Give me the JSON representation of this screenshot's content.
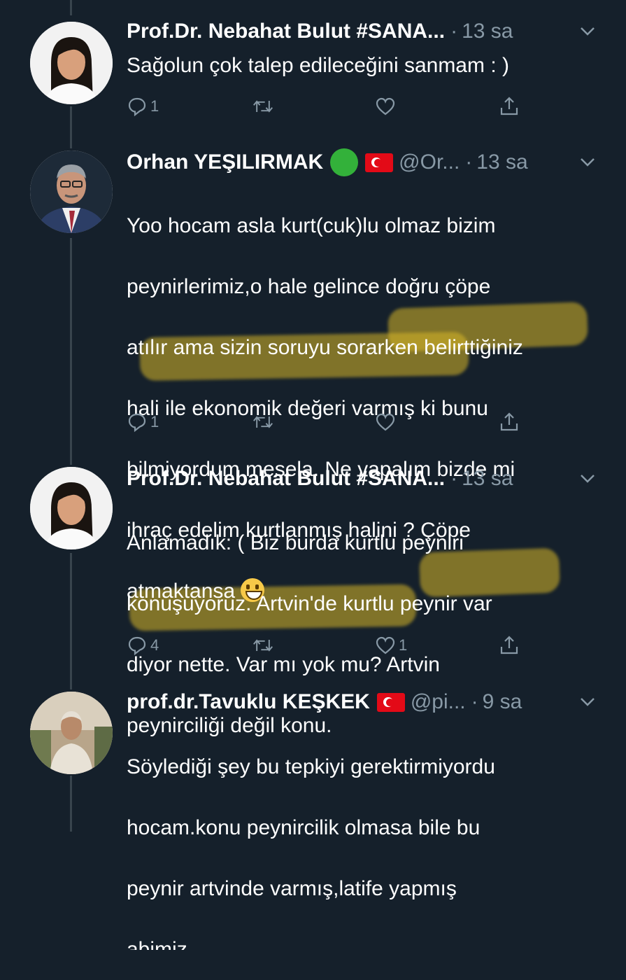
{
  "tweets": [
    {
      "name": "Prof.Dr. Nebahat Bulut #SANA...",
      "handle": "",
      "time": "13 sa",
      "text": "Sağolun çok talep edileceğini sanmam : )",
      "reply_count": "1",
      "like_count": ""
    },
    {
      "name": "Orhan YEŞILIRMAK",
      "handle": "@Or...",
      "time": "13 sa",
      "text_lines": [
        "Yoo hocam asla kurt(cuk)lu olmaz bizim",
        "peynirlerimiz,o hale gelince doğru çöpe",
        "atılır ama sizin soruyu sorarken belirttiğiniz",
        "hali ile ekonomik değeri varmış ki bunu",
        "bilmiyordum mesela. Ne yapalım bizde mi",
        "ihraç edelim kurtlanmış halini ? Çöpe",
        "atmaktansa"
      ],
      "reply_count": "1",
      "like_count": ""
    },
    {
      "name": "Prof.Dr. Nebahat Bulut #SANA...",
      "handle": "",
      "time": "13 sa",
      "text_lines": [
        "Anlamadık: ( Biz burda kurtlu peyniri",
        "konuşuyoruz. Artvin'de kurtlu peynir var",
        "diyor nette. Var mı yok mu? Artvin",
        "peynirciliği değil konu."
      ],
      "reply_count": "4",
      "like_count": "1"
    },
    {
      "name": "prof.dr.Tavuklu KEŞKEK",
      "handle": "@pi...",
      "time": "9 sa",
      "text_lines": [
        "Söylediği şey bu tepkiyi gerektirmiyordu",
        "hocam.konu peynircilik olmasa bile bu",
        "peynir artvinde varmış,latife yapmış",
        "abimiz"
      ]
    }
  ],
  "separator": "·",
  "colors": {
    "background": "#15202b",
    "secondary_text": "#8899a6",
    "highlight": "#d8b728"
  }
}
